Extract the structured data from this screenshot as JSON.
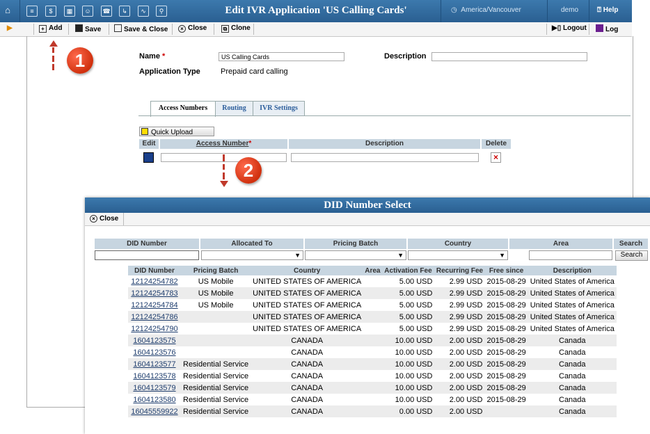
{
  "header": {
    "title": "Edit IVR Application 'US Calling Cards'",
    "timezone": "America/Vancouver",
    "user": "demo",
    "help": "Help"
  },
  "toolbar": {
    "add": "Add",
    "save": "Save",
    "save_close": "Save & Close",
    "close": "Close",
    "clone": "Clone",
    "logout": "Logout",
    "log": "Log"
  },
  "form": {
    "name_label": "Name",
    "name_value": "US Calling Cards",
    "description_label": "Description",
    "description_value": "",
    "apptype_label": "Application Type",
    "apptype_value": "Prepaid card calling"
  },
  "tabs": [
    "Access Numbers",
    "Routing",
    "IVR Settings"
  ],
  "access": {
    "quick_upload": "Quick Upload",
    "headers": {
      "edit": "Edit",
      "number": "Access Number",
      "description": "Description",
      "delete": "Delete"
    }
  },
  "annotations": {
    "one": "1",
    "two": "2"
  },
  "popup": {
    "title": "DID Number Select",
    "close": "Close",
    "filters": [
      "DID Number",
      "Allocated To",
      "Pricing Batch",
      "Country",
      "Area",
      "Search"
    ],
    "search_button": "Search",
    "columns": [
      "DID Number",
      "Pricing Batch",
      "Country",
      "Area",
      "Activation Fee",
      "Recurring Fee",
      "Free since",
      "Description"
    ],
    "rows": [
      [
        "12124254782",
        "US Mobile",
        "UNITED STATES OF AMERICA",
        "",
        "5.00 USD",
        "2.99 USD",
        "2015-08-29",
        "United States of America"
      ],
      [
        "12124254783",
        "US Mobile",
        "UNITED STATES OF AMERICA",
        "",
        "5.00 USD",
        "2.99 USD",
        "2015-08-29",
        "United States of America"
      ],
      [
        "12124254784",
        "US Mobile",
        "UNITED STATES OF AMERICA",
        "",
        "5.00 USD",
        "2.99 USD",
        "2015-08-29",
        "United States of America"
      ],
      [
        "12124254786",
        "",
        "UNITED STATES OF AMERICA",
        "",
        "5.00 USD",
        "2.99 USD",
        "2015-08-29",
        "United States of America"
      ],
      [
        "12124254790",
        "",
        "UNITED STATES OF AMERICA",
        "",
        "5.00 USD",
        "2.99 USD",
        "2015-08-29",
        "United States of America"
      ],
      [
        "1604123575",
        "",
        "CANADA",
        "",
        "10.00 USD",
        "2.00 USD",
        "2015-08-29",
        "Canada"
      ],
      [
        "1604123576",
        "",
        "CANADA",
        "",
        "10.00 USD",
        "2.00 USD",
        "2015-08-29",
        "Canada"
      ],
      [
        "1604123577",
        "Residential Service",
        "CANADA",
        "",
        "10.00 USD",
        "2.00 USD",
        "2015-08-29",
        "Canada"
      ],
      [
        "1604123578",
        "Residential Service",
        "CANADA",
        "",
        "10.00 USD",
        "2.00 USD",
        "2015-08-29",
        "Canada"
      ],
      [
        "1604123579",
        "Residential Service",
        "CANADA",
        "",
        "10.00 USD",
        "2.00 USD",
        "2015-08-29",
        "Canada"
      ],
      [
        "1604123580",
        "Residential Service",
        "CANADA",
        "",
        "10.00 USD",
        "2.00 USD",
        "2015-08-29",
        "Canada"
      ],
      [
        "16045559922",
        "Residential Service",
        "CANADA",
        "",
        "0.00 USD",
        "2.00 USD",
        "",
        "Canada"
      ]
    ]
  }
}
